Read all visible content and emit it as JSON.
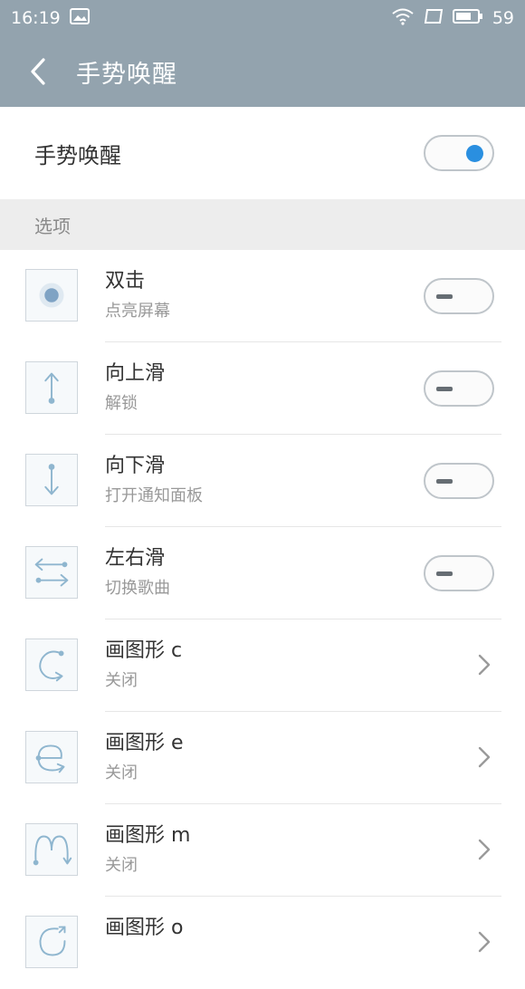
{
  "status_bar": {
    "time": "16:19",
    "battery": "59",
    "icons": [
      "image-icon",
      "wifi-icon",
      "tablet-icon",
      "battery-icon"
    ]
  },
  "title_bar": {
    "title": "手势唤醒",
    "back_icon": "chevron-left-icon"
  },
  "main_toggle": {
    "label": "手势唤醒",
    "state": "on"
  },
  "section": {
    "title": "选项"
  },
  "options": [
    {
      "title": "双击",
      "subtitle": "点亮屏幕",
      "control": "toggle",
      "state": "off",
      "icon": "double-tap-icon"
    },
    {
      "title": "向上滑",
      "subtitle": "解锁",
      "control": "toggle",
      "state": "off",
      "icon": "swipe-up-icon"
    },
    {
      "title": "向下滑",
      "subtitle": "打开通知面板",
      "control": "toggle",
      "state": "off",
      "icon": "swipe-down-icon"
    },
    {
      "title": "左右滑",
      "subtitle": "切换歌曲",
      "control": "toggle",
      "state": "off",
      "icon": "swipe-left-right-icon"
    },
    {
      "title": "画图形 c",
      "subtitle": "关闭",
      "control": "chevron",
      "icon": "gesture-c-icon"
    },
    {
      "title": "画图形 e",
      "subtitle": "关闭",
      "control": "chevron",
      "icon": "gesture-e-icon"
    },
    {
      "title": "画图形 m",
      "subtitle": "关闭",
      "control": "chevron",
      "icon": "gesture-m-icon"
    },
    {
      "title": "画图形 o",
      "subtitle": "",
      "control": "chevron",
      "icon": "gesture-o-icon"
    }
  ],
  "colors": {
    "header": "#93a3ae",
    "accent": "#2a8fe0",
    "icon_stroke": "#8fb6cf"
  }
}
